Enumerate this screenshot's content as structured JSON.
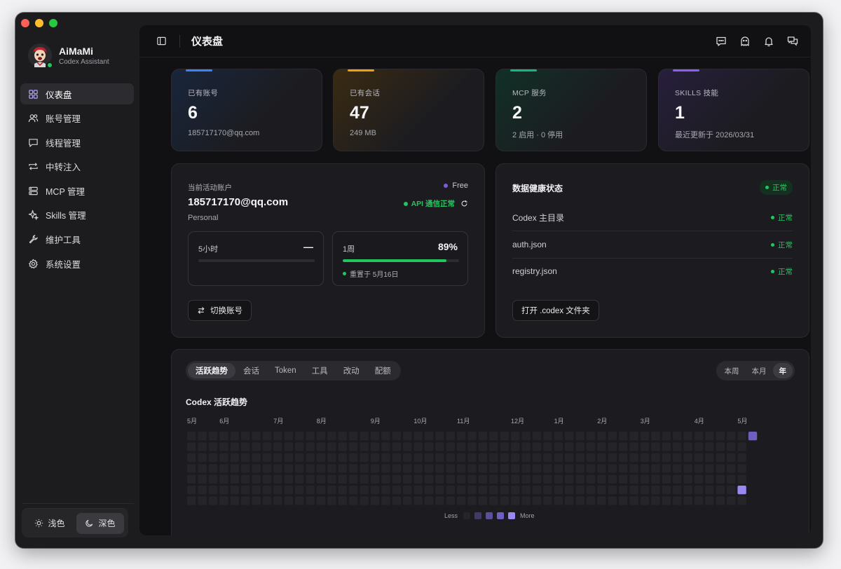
{
  "window": {
    "title": "仪表盘"
  },
  "profile": {
    "name": "AiMaMi",
    "subtitle": "Codex Assistant"
  },
  "sidebar": {
    "items": [
      {
        "key": "dashboard",
        "label": "仪表盘",
        "icon": "grid-icon",
        "active": true
      },
      {
        "key": "accounts",
        "label": "账号管理",
        "icon": "users-icon"
      },
      {
        "key": "threads",
        "label": "线程管理",
        "icon": "chat-icon"
      },
      {
        "key": "relay",
        "label": "中转注入",
        "icon": "repeat-icon"
      },
      {
        "key": "mcp",
        "label": "MCP 管理",
        "icon": "server-icon"
      },
      {
        "key": "skills",
        "label": "Skills 管理",
        "icon": "sparkle-icon"
      },
      {
        "key": "tools",
        "label": "维护工具",
        "icon": "wrench-icon"
      },
      {
        "key": "settings",
        "label": "系统设置",
        "icon": "gear-icon"
      }
    ],
    "theme": {
      "light_label": "浅色",
      "dark_label": "深色",
      "selected": "dark"
    }
  },
  "stats": [
    {
      "label": "已有账号",
      "value": "6",
      "sub": "185717170@qq.com",
      "color": "#3b82f6"
    },
    {
      "label": "已有会话",
      "value": "47",
      "sub": "249 MB",
      "color": "#f59e0b"
    },
    {
      "label": "MCP 服务",
      "value": "2",
      "sub": "2 启用 · 0 停用",
      "color": "#10b981"
    },
    {
      "label": "SKILLS 技能",
      "value": "1",
      "sub": "最近更新于 2026/03/31",
      "color": "#8b5cf6"
    }
  ],
  "account": {
    "label": "当前活动账户",
    "email": "185717170@qq.com",
    "type": "Personal",
    "plan": "Free",
    "api_status": "API 通信正常",
    "quotas": [
      {
        "name": "5小时",
        "value": "—",
        "percent": 0,
        "reset": ""
      },
      {
        "name": "1周",
        "value": "89%",
        "percent": 89,
        "reset": "重置于 5月16日"
      }
    ],
    "switch_label": "切换账号"
  },
  "health": {
    "title": "数据健康状态",
    "overall": "正常",
    "rows": [
      {
        "name": "Codex 主目录",
        "status": "正常"
      },
      {
        "name": "auth.json",
        "status": "正常"
      },
      {
        "name": "registry.json",
        "status": "正常"
      }
    ],
    "open_label": "打开 .codex 文件夹"
  },
  "activity": {
    "tabs": [
      "活跃趋势",
      "会话",
      "Token",
      "工具",
      "改动",
      "配额"
    ],
    "active_tab": 0,
    "ranges": [
      "本周",
      "本月",
      "年"
    ],
    "active_range": 2
  },
  "chart_data": {
    "type": "heatmap",
    "title": "Codex 活跃趋势",
    "weeks": 53,
    "days": 7,
    "month_labels": [
      {
        "label": "5月",
        "week": 0
      },
      {
        "label": "6月",
        "week": 3
      },
      {
        "label": "7月",
        "week": 8
      },
      {
        "label": "8月",
        "week": 12
      },
      {
        "label": "9月",
        "week": 17
      },
      {
        "label": "10月",
        "week": 21
      },
      {
        "label": "11月",
        "week": 25
      },
      {
        "label": "12月",
        "week": 30
      },
      {
        "label": "1月",
        "week": 34
      },
      {
        "label": "2月",
        "week": 38
      },
      {
        "label": "3月",
        "week": 42
      },
      {
        "label": "4月",
        "week": 47
      },
      {
        "label": "5月",
        "week": 51
      }
    ],
    "active_cells": [
      {
        "week": 52,
        "day": 0,
        "level": 3
      },
      {
        "week": 51,
        "day": 5,
        "level": 4
      }
    ],
    "current_week": 52,
    "current_week_days": 1,
    "levels": [
      "#252529",
      "#3f3a66",
      "#5a4f9c",
      "#6e5fc0",
      "#9b87f0"
    ],
    "legend_less": "Less",
    "legend_more": "More"
  }
}
